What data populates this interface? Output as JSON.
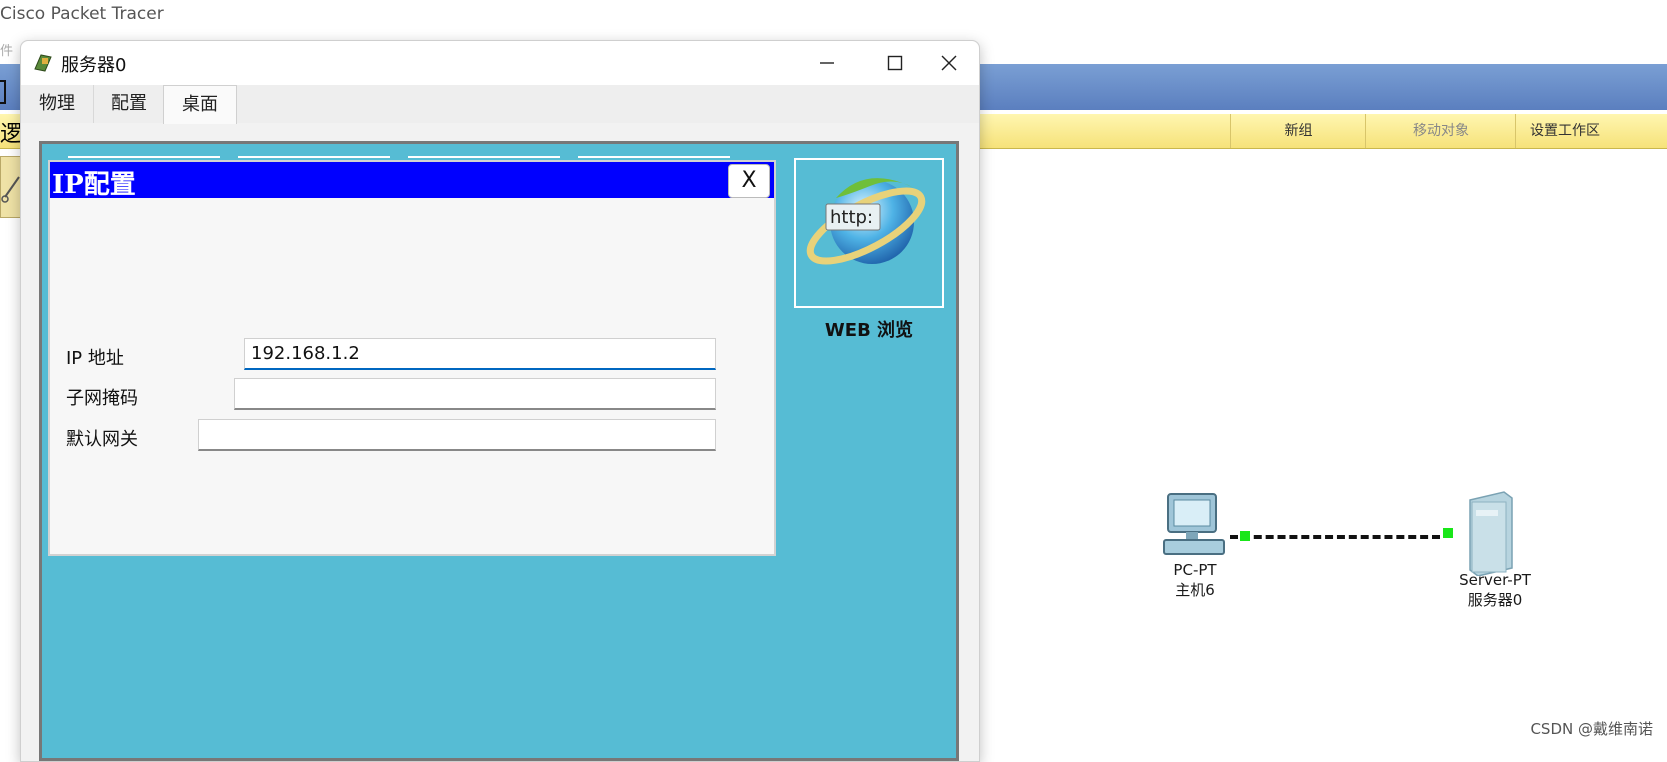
{
  "app": {
    "title": "Cisco Packet Tracer",
    "menu_stub": "件",
    "logic_label": "逻",
    "yellow_toolbar": [
      "新组",
      "移动对象",
      "设置工作区"
    ]
  },
  "dialog": {
    "title": "服务器0",
    "tabs": [
      {
        "label": "物理"
      },
      {
        "label": "配置"
      },
      {
        "label": "桌面"
      }
    ],
    "active_tab": "桌面"
  },
  "desktop": {
    "web_browser": {
      "icon_text": "http:",
      "label": "WEB 浏览"
    }
  },
  "ip_config": {
    "title": "IP配置",
    "close_label": "X",
    "fields": [
      {
        "label": "IP 地址",
        "value": "192.168.1.2"
      },
      {
        "label": "子网掩码",
        "value": ""
      },
      {
        "label": "默认网关",
        "value": ""
      }
    ]
  },
  "topology": {
    "pc": {
      "type": "PC-PT",
      "name": "主机6"
    },
    "server": {
      "type": "Server-PT",
      "name": "服务器0"
    },
    "link_color": "#19e619"
  },
  "watermark": "CSDN @戴维南诺",
  "colors": {
    "ip_title_bar": "#0000ff",
    "desktop_bg": "#56bcd4",
    "toolbar_blue": "#6b8fd0",
    "toolbar_yellow": "#f6e27a"
  }
}
